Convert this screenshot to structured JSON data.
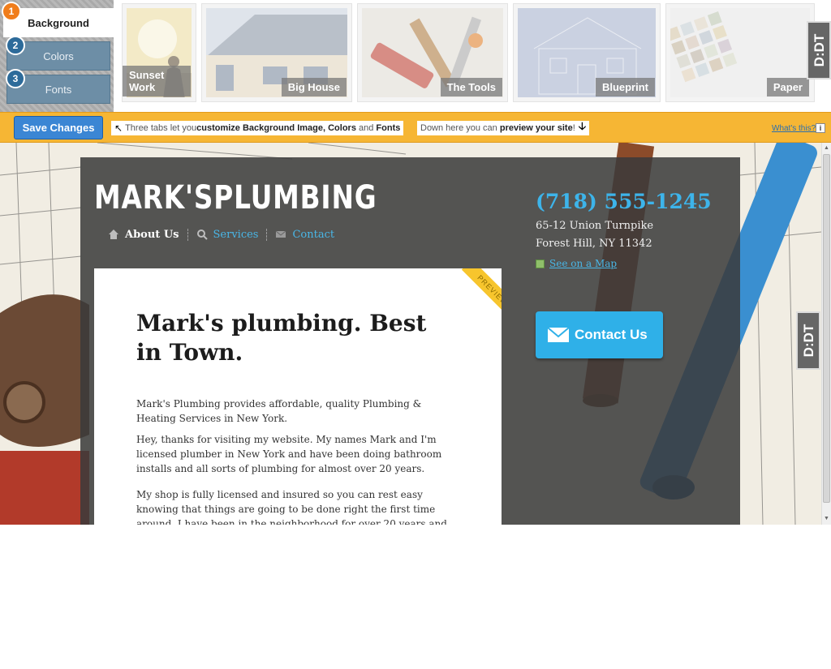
{
  "tabs": [
    {
      "num": "1",
      "label": "Background"
    },
    {
      "num": "2",
      "label": "Colors"
    },
    {
      "num": "3",
      "label": "Fonts"
    }
  ],
  "thumbnails": [
    {
      "label": "Sunset Work",
      "icon": "sunset-worker-image"
    },
    {
      "label": "Big House",
      "icon": "house-image"
    },
    {
      "label": "The Tools",
      "icon": "tools-image"
    },
    {
      "label": "Blueprint",
      "icon": "blueprint-image"
    },
    {
      "label": "Paper",
      "icon": "color-swatch-paper-image"
    }
  ],
  "ddt_badge": "D:DT",
  "toolbar": {
    "save_label": "Save Changes",
    "hint_tabs": {
      "pre": "Three tabs let you ",
      "b1": "customize Background Image, Colors",
      "mid": " and ",
      "b2": "Fonts"
    },
    "hint_preview": {
      "pre": "Down here you can ",
      "b": "preview your site",
      "post": "!"
    },
    "whats_this": "What's this?",
    "info": "i"
  },
  "site": {
    "logo": "MARK'SPLUMBING",
    "nav": [
      {
        "label": "About Us",
        "icon": "home-icon"
      },
      {
        "label": "Services",
        "icon": "search-icon"
      },
      {
        "label": "Contact",
        "icon": "mail-icon"
      }
    ],
    "phone": "(718) 555-1245",
    "address1": "65-12 Union Turnpike",
    "address2": "Forest Hill, NY 11342",
    "map_link": "See on a Map",
    "contact_button": "Contact Us",
    "ribbon": "PREVIEW",
    "headline": "Mark's plumbing. Best in Town.",
    "paragraphs": [
      "Mark's Plumbing provides affordable, quality Plumbing & Heating Services in New York.",
      "Hey, thanks for visiting my website. My names Mark and I'm licensed plumber in New York and have been doing bathroom installs and all sorts of plumbing for almost over 20 years.",
      "My shop is fully licensed and insured so you can rest easy knowing that things are going to be done right the first time around. I have been in the neighborhood for over 20 years and people know me around here."
    ]
  },
  "colors": {
    "accent_orange": "#f6b634",
    "save_blue": "#3b86d4",
    "link_blue": "#3db4ea"
  }
}
